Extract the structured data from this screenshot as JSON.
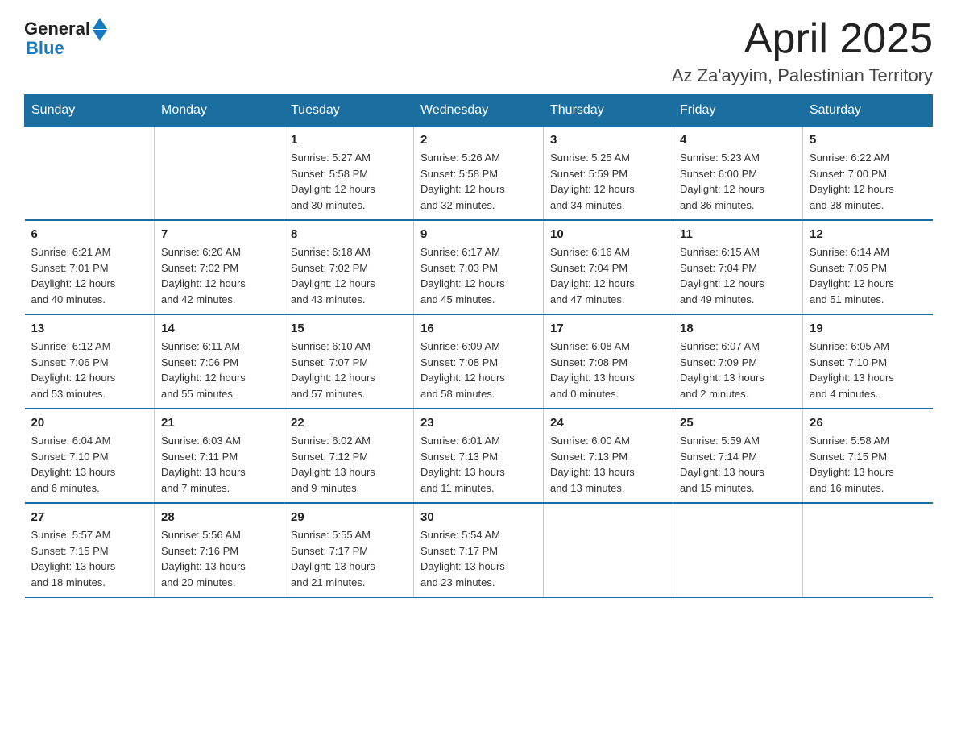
{
  "header": {
    "logo_general": "General",
    "logo_blue": "Blue",
    "month_year": "April 2025",
    "location": "Az Za'ayyim, Palestinian Territory"
  },
  "days_of_week": [
    "Sunday",
    "Monday",
    "Tuesday",
    "Wednesday",
    "Thursday",
    "Friday",
    "Saturday"
  ],
  "weeks": [
    [
      {
        "day": "",
        "info": ""
      },
      {
        "day": "",
        "info": ""
      },
      {
        "day": "1",
        "info": "Sunrise: 5:27 AM\nSunset: 5:58 PM\nDaylight: 12 hours\nand 30 minutes."
      },
      {
        "day": "2",
        "info": "Sunrise: 5:26 AM\nSunset: 5:58 PM\nDaylight: 12 hours\nand 32 minutes."
      },
      {
        "day": "3",
        "info": "Sunrise: 5:25 AM\nSunset: 5:59 PM\nDaylight: 12 hours\nand 34 minutes."
      },
      {
        "day": "4",
        "info": "Sunrise: 5:23 AM\nSunset: 6:00 PM\nDaylight: 12 hours\nand 36 minutes."
      },
      {
        "day": "5",
        "info": "Sunrise: 6:22 AM\nSunset: 7:00 PM\nDaylight: 12 hours\nand 38 minutes."
      }
    ],
    [
      {
        "day": "6",
        "info": "Sunrise: 6:21 AM\nSunset: 7:01 PM\nDaylight: 12 hours\nand 40 minutes."
      },
      {
        "day": "7",
        "info": "Sunrise: 6:20 AM\nSunset: 7:02 PM\nDaylight: 12 hours\nand 42 minutes."
      },
      {
        "day": "8",
        "info": "Sunrise: 6:18 AM\nSunset: 7:02 PM\nDaylight: 12 hours\nand 43 minutes."
      },
      {
        "day": "9",
        "info": "Sunrise: 6:17 AM\nSunset: 7:03 PM\nDaylight: 12 hours\nand 45 minutes."
      },
      {
        "day": "10",
        "info": "Sunrise: 6:16 AM\nSunset: 7:04 PM\nDaylight: 12 hours\nand 47 minutes."
      },
      {
        "day": "11",
        "info": "Sunrise: 6:15 AM\nSunset: 7:04 PM\nDaylight: 12 hours\nand 49 minutes."
      },
      {
        "day": "12",
        "info": "Sunrise: 6:14 AM\nSunset: 7:05 PM\nDaylight: 12 hours\nand 51 minutes."
      }
    ],
    [
      {
        "day": "13",
        "info": "Sunrise: 6:12 AM\nSunset: 7:06 PM\nDaylight: 12 hours\nand 53 minutes."
      },
      {
        "day": "14",
        "info": "Sunrise: 6:11 AM\nSunset: 7:06 PM\nDaylight: 12 hours\nand 55 minutes."
      },
      {
        "day": "15",
        "info": "Sunrise: 6:10 AM\nSunset: 7:07 PM\nDaylight: 12 hours\nand 57 minutes."
      },
      {
        "day": "16",
        "info": "Sunrise: 6:09 AM\nSunset: 7:08 PM\nDaylight: 12 hours\nand 58 minutes."
      },
      {
        "day": "17",
        "info": "Sunrise: 6:08 AM\nSunset: 7:08 PM\nDaylight: 13 hours\nand 0 minutes."
      },
      {
        "day": "18",
        "info": "Sunrise: 6:07 AM\nSunset: 7:09 PM\nDaylight: 13 hours\nand 2 minutes."
      },
      {
        "day": "19",
        "info": "Sunrise: 6:05 AM\nSunset: 7:10 PM\nDaylight: 13 hours\nand 4 minutes."
      }
    ],
    [
      {
        "day": "20",
        "info": "Sunrise: 6:04 AM\nSunset: 7:10 PM\nDaylight: 13 hours\nand 6 minutes."
      },
      {
        "day": "21",
        "info": "Sunrise: 6:03 AM\nSunset: 7:11 PM\nDaylight: 13 hours\nand 7 minutes."
      },
      {
        "day": "22",
        "info": "Sunrise: 6:02 AM\nSunset: 7:12 PM\nDaylight: 13 hours\nand 9 minutes."
      },
      {
        "day": "23",
        "info": "Sunrise: 6:01 AM\nSunset: 7:13 PM\nDaylight: 13 hours\nand 11 minutes."
      },
      {
        "day": "24",
        "info": "Sunrise: 6:00 AM\nSunset: 7:13 PM\nDaylight: 13 hours\nand 13 minutes."
      },
      {
        "day": "25",
        "info": "Sunrise: 5:59 AM\nSunset: 7:14 PM\nDaylight: 13 hours\nand 15 minutes."
      },
      {
        "day": "26",
        "info": "Sunrise: 5:58 AM\nSunset: 7:15 PM\nDaylight: 13 hours\nand 16 minutes."
      }
    ],
    [
      {
        "day": "27",
        "info": "Sunrise: 5:57 AM\nSunset: 7:15 PM\nDaylight: 13 hours\nand 18 minutes."
      },
      {
        "day": "28",
        "info": "Sunrise: 5:56 AM\nSunset: 7:16 PM\nDaylight: 13 hours\nand 20 minutes."
      },
      {
        "day": "29",
        "info": "Sunrise: 5:55 AM\nSunset: 7:17 PM\nDaylight: 13 hours\nand 21 minutes."
      },
      {
        "day": "30",
        "info": "Sunrise: 5:54 AM\nSunset: 7:17 PM\nDaylight: 13 hours\nand 23 minutes."
      },
      {
        "day": "",
        "info": ""
      },
      {
        "day": "",
        "info": ""
      },
      {
        "day": "",
        "info": ""
      }
    ]
  ]
}
